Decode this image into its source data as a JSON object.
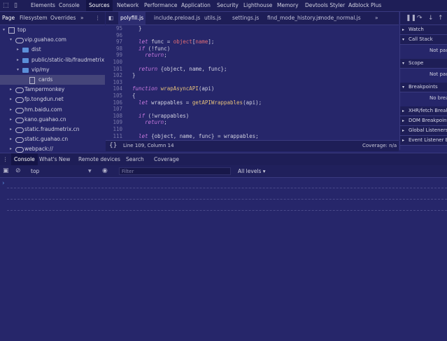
{
  "top_tabs": [
    "Elements",
    "Console",
    "Sources",
    "Network",
    "Performance",
    "Application",
    "Security",
    "Lighthouse",
    "Memory",
    "Devtools Styler",
    "Adblock Plus"
  ],
  "active_top_tab": "Sources",
  "navigator": {
    "tabs": [
      "Page",
      "Filesystem",
      "Overrides",
      "»"
    ],
    "tree": [
      {
        "label": "top",
        "icon": "square-icon",
        "indent": 0,
        "arrow": "▾"
      },
      {
        "label": "vip.guahao.com",
        "icon": "cloud-icon",
        "indent": 1,
        "arrow": "▾"
      },
      {
        "label": "dist",
        "icon": "folder-icon",
        "indent": 2,
        "arrow": "▸"
      },
      {
        "label": "public/static-lib/fraudmetrix",
        "icon": "folder-icon",
        "indent": 2,
        "arrow": "▸"
      },
      {
        "label": "vip/my",
        "icon": "folder-icon",
        "indent": 2,
        "arrow": "▾"
      },
      {
        "label": "cards",
        "icon": "file-icon",
        "indent": 3,
        "arrow": "",
        "selected": true
      },
      {
        "label": "Tampermonkey",
        "icon": "cloud-icon",
        "indent": 1,
        "arrow": "▸"
      },
      {
        "label": "fp.tongdun.net",
        "icon": "cloud-icon",
        "indent": 1,
        "arrow": "▸"
      },
      {
        "label": "hm.baidu.com",
        "icon": "cloud-icon",
        "indent": 1,
        "arrow": "▸"
      },
      {
        "label": "kano.guahao.cn",
        "icon": "cloud-icon",
        "indent": 1,
        "arrow": "▸"
      },
      {
        "label": "static.fraudmetrix.cn",
        "icon": "cloud-icon",
        "indent": 1,
        "arrow": "▸"
      },
      {
        "label": "static.guahao.cn",
        "icon": "cloud-icon",
        "indent": 1,
        "arrow": "▸"
      },
      {
        "label": "webpack://",
        "icon": "cloud-icon",
        "indent": 1,
        "arrow": "▸"
      }
    ]
  },
  "editor": {
    "tabs": [
      "polyfill.js",
      "include.preload.js",
      "utils.js",
      "settings.js",
      "find_mode_history.js",
      "mode_normal.js",
      "»"
    ],
    "active_tab": "polyfill.js",
    "lines": [
      {
        "n": "95",
        "code": [
          {
            "t": "    }",
            "c": "pu"
          }
        ]
      },
      {
        "n": "96",
        "code": []
      },
      {
        "n": "97",
        "code": [
          {
            "t": "    let ",
            "c": "kw"
          },
          {
            "t": "func = ",
            "c": "pu"
          },
          {
            "t": "object",
            "c": "var"
          },
          {
            "t": "[",
            "c": "pu"
          },
          {
            "t": "name",
            "c": "var"
          },
          {
            "t": "];",
            "c": "pu"
          }
        ]
      },
      {
        "n": "98",
        "code": [
          {
            "t": "    if ",
            "c": "kw"
          },
          {
            "t": "(!func)",
            "c": "pu"
          }
        ]
      },
      {
        "n": "99",
        "code": [
          {
            "t": "      return",
            "c": "kw"
          },
          {
            "t": ";",
            "c": "pu"
          }
        ]
      },
      {
        "n": "100",
        "code": []
      },
      {
        "n": "101",
        "code": [
          {
            "t": "    return ",
            "c": "kw"
          },
          {
            "t": "{object, name, func};",
            "c": "pu"
          }
        ]
      },
      {
        "n": "102",
        "code": [
          {
            "t": "  }",
            "c": "pu"
          }
        ]
      },
      {
        "n": "103",
        "code": []
      },
      {
        "n": "104",
        "code": [
          {
            "t": "  function ",
            "c": "kw"
          },
          {
            "t": "wrapAsyncAPI",
            "c": "fn"
          },
          {
            "t": "(api)",
            "c": "pu"
          }
        ]
      },
      {
        "n": "105",
        "code": [
          {
            "t": "  {",
            "c": "pu"
          }
        ]
      },
      {
        "n": "106",
        "code": [
          {
            "t": "    let ",
            "c": "kw"
          },
          {
            "t": "wrappables = ",
            "c": "pu"
          },
          {
            "t": "getAPIWrappables",
            "c": "fn"
          },
          {
            "t": "(api);",
            "c": "pu"
          }
        ]
      },
      {
        "n": "107",
        "code": []
      },
      {
        "n": "108",
        "code": [
          {
            "t": "    if ",
            "c": "kw"
          },
          {
            "t": "(!wrappables)",
            "c": "pu"
          }
        ]
      },
      {
        "n": "109",
        "code": [
          {
            "t": "      return",
            "c": "kw"
          },
          {
            "t": ";",
            "c": "pu"
          }
        ]
      },
      {
        "n": "110",
        "code": []
      },
      {
        "n": "111",
        "code": [
          {
            "t": "    let ",
            "c": "kw"
          },
          {
            "t": "{object, name, func} = wrappables;",
            "c": "pu"
          }
        ]
      }
    ]
  },
  "status": {
    "braces": "{}",
    "position": "Line 109, Column 14",
    "coverage": "Coverage: n/a"
  },
  "debugger": {
    "sections": [
      {
        "label": "Watch",
        "arrow": "▸"
      },
      {
        "label": "Call Stack",
        "arrow": "▾",
        "body": "Not paused"
      },
      {
        "label": "Scope",
        "arrow": "▾",
        "body": "Not paused"
      },
      {
        "label": "Breakpoints",
        "arrow": "▾",
        "body": "No breakpoints"
      },
      {
        "label": "XHR/fetch Breakpoints",
        "arrow": "▸"
      },
      {
        "label": "DOM Breakpoints",
        "arrow": "▸"
      },
      {
        "label": "Global Listeners",
        "arrow": "▸"
      },
      {
        "label": "Event Listener Breakpoints",
        "arrow": "▸"
      }
    ]
  },
  "drawer": {
    "tabs": [
      "Console",
      "What's New",
      "Remote devices",
      "Search",
      "Coverage"
    ],
    "active_tab": "Console",
    "context": "top",
    "filter_placeholder": "Filter",
    "levels": "All levels ▾",
    "prompt": "›"
  }
}
